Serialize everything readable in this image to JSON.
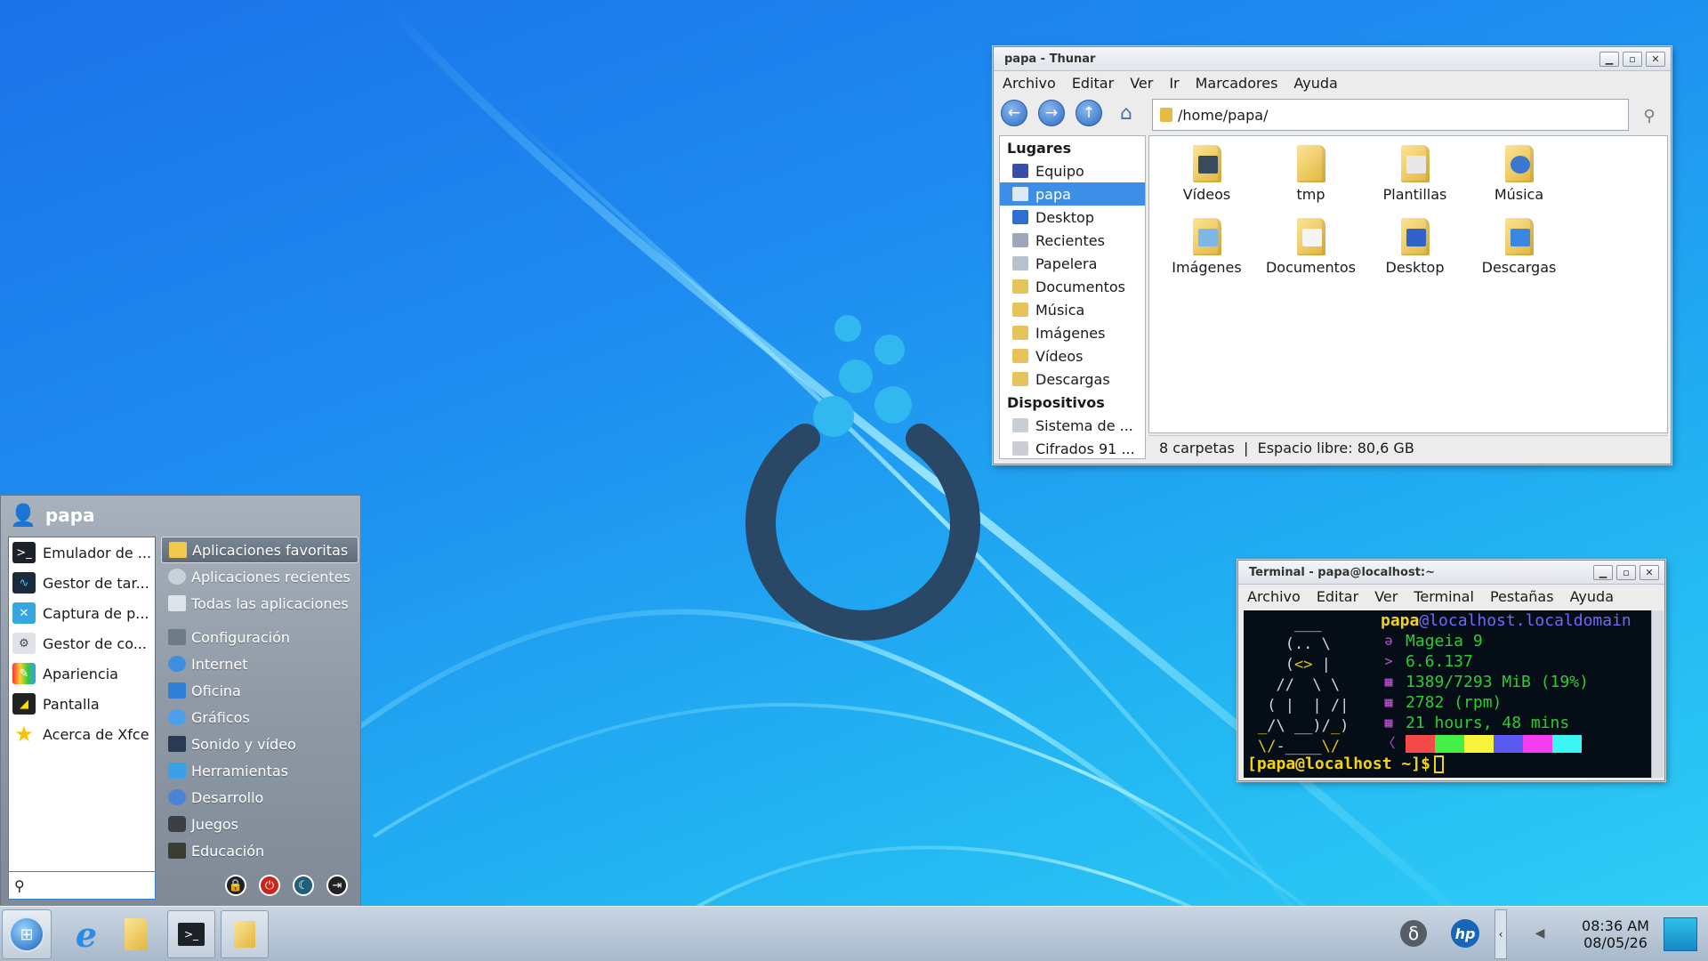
{
  "thunar": {
    "title": "papa - Thunar",
    "menu": [
      "Archivo",
      "Editar",
      "Ver",
      "Ir",
      "Marcadores",
      "Ayuda"
    ],
    "address": "/home/papa/",
    "sidebar": {
      "places_header": "Lugares",
      "places": [
        "Equipo",
        "papa",
        "Desktop",
        "Recientes",
        "Papelera",
        "Documentos",
        "Música",
        "Imágenes",
        "Vídeos",
        "Descargas"
      ],
      "selected": "papa",
      "devices_header": "Dispositivos",
      "devices": [
        "Sistema de ...",
        "Cifrados 91 ..."
      ]
    },
    "files": [
      "Vídeos",
      "tmp",
      "Plantillas",
      "Música",
      "Imágenes",
      "Documentos",
      "Desktop",
      "Descargas"
    ],
    "status": "8 carpetas  |  Espacio libre: 80,6 GB"
  },
  "terminal": {
    "title": "Terminal - papa@localhost:~",
    "menu": [
      "Archivo",
      "Editar",
      "Ver",
      "Terminal",
      "Pestañas",
      "Ayuda"
    ],
    "user": "papa",
    "host": "@localhost.localdomain",
    "info": [
      {
        "icon": "ə",
        "value": "Mageia 9"
      },
      {
        "icon": ">",
        "value": "6.6.137"
      },
      {
        "icon": "▦",
        "value": "1389/7293 MiB (19%)"
      },
      {
        "icon": "▦",
        "value": "2782 (rpm)"
      },
      {
        "icon": "▦",
        "value": "21 hours, 48 mins"
      }
    ],
    "palette_icon": "〈",
    "palette": [
      "#f44a4a",
      "#44f047",
      "#f6f43c",
      "#5a5af0",
      "#f43cf0",
      "#3cf6f6"
    ],
    "prompt": "[papa@localhost ~]$"
  },
  "startmenu": {
    "user": "papa",
    "favorites": [
      "Emulador de ...",
      "Gestor de tar...",
      "Captura de p...",
      "Gestor de co...",
      "Apariencia",
      "Pantalla",
      "Acerca de Xfce"
    ],
    "categories_top": [
      "Aplicaciones favoritas",
      "Aplicaciones recientes",
      "Todas las aplicaciones"
    ],
    "categories": [
      "Configuración",
      "Internet",
      "Oficina",
      "Gráficos",
      "Sonido y vídeo",
      "Herramientas",
      "Desarrollo",
      "Juegos",
      "Educación"
    ],
    "search_placeholder": ""
  },
  "taskbar": {
    "time": "08:36 AM",
    "date": "08/05/26"
  },
  "colors": {
    "accent": "#3d8ee6",
    "desktop": "#1e8cf0"
  }
}
